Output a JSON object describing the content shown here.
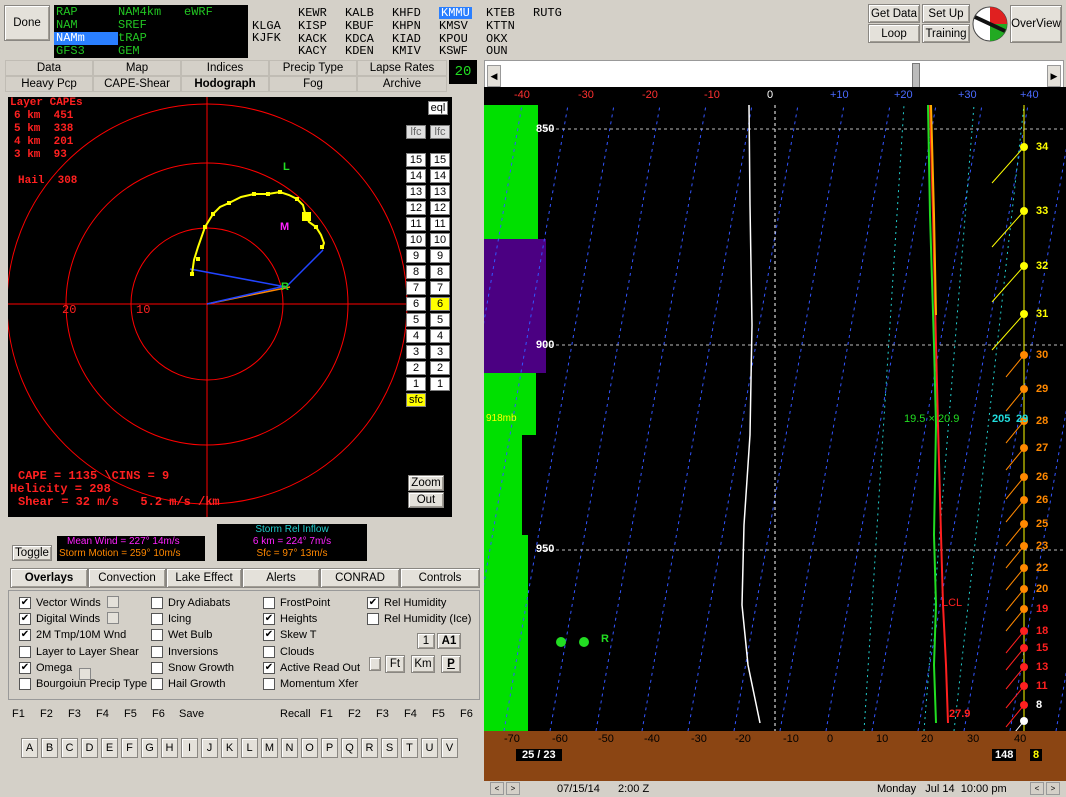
{
  "toolbar": {
    "done": "Done",
    "get_data": "Get Data",
    "set_up": "Set Up",
    "loop": "Loop",
    "training": "Training",
    "overview": "OverView",
    "frame_count": "20"
  },
  "models": [
    {
      "label": "RAP"
    },
    {
      "label": "NAM4km"
    },
    {
      "label": "eWRF"
    },
    {
      "label": "NAM"
    },
    {
      "label": "SREF"
    },
    {
      "label": "NAMm"
    },
    {
      "label": "tRAP"
    },
    {
      "label": "GFS3"
    },
    {
      "label": "GEM"
    }
  ],
  "stations": [
    "KLGA",
    "KJFK",
    "KEWR",
    "KISP",
    "KACK",
    "KACY",
    "KALB",
    "KBUF",
    "KDCA",
    "KDEN",
    "KHFD",
    "KHPN",
    "KIAD",
    "KMIV",
    "KMMU",
    "KMSV",
    "KPOU",
    "KSWF",
    "KTEB",
    "KTTN",
    "OKX",
    "OUN",
    "RUTG"
  ],
  "tabs_row1": [
    "Data",
    "Map",
    "Indices",
    "Precip Type",
    "Lapse Rates"
  ],
  "tabs_row2": [
    "Heavy Pcp",
    "CAPE-Shear",
    "Hodograph",
    "Fog",
    "Archive"
  ],
  "hodograph": {
    "layer_capes_title": "Layer CAPEs",
    "layer_capes": [
      "6 km  451",
      "5 km  338",
      "4 km  201",
      "3 km  93"
    ],
    "hail": "Hail  308",
    "ring_labels": [
      "20",
      "10"
    ],
    "marker_L": "L",
    "marker_M": "M",
    "marker_R": "R",
    "eql": "eql",
    "lfc1": "lfc",
    "lfc2": "lfc",
    "levels_left": [
      "15",
      "14",
      "13",
      "12",
      "11",
      "10",
      "9",
      "8",
      "7",
      "6",
      "5",
      "4",
      "3",
      "2",
      "1"
    ],
    "levels_right": [
      "15",
      "14",
      "13",
      "12",
      "11",
      "10",
      "9",
      "8",
      "7",
      "6",
      "5",
      "4",
      "3",
      "2",
      "1"
    ],
    "sfc": "sfc",
    "cape": "CAPE = 1135 \\CINS = 9",
    "helicity": "Helicity = 298",
    "shear": "Shear = 32 m/s   5.2 m/s /km",
    "zoom": "Zoom",
    "out": "Out"
  },
  "wind_info": {
    "toggle": "Toggle",
    "mean_wind": "Mean Wind = 227°  14m/s",
    "storm_motion": "Storm Motion = 259°  10m/s",
    "sri_title": "Storm Rel Inflow",
    "sri_6km": "6 km = 224°  7m/s",
    "sri_sfc": "Sfc = 97°  13m/s"
  },
  "section_tabs": [
    "Overlays",
    "Convection",
    "Lake Effect",
    "Alerts",
    "CONRAD",
    "Controls"
  ],
  "overlays": {
    "col1": [
      {
        "label": "Vector Winds",
        "checked": true
      },
      {
        "label": "Digital Winds",
        "checked": true
      },
      {
        "label": "2M Tmp/10M Wnd",
        "checked": true
      },
      {
        "label": "Layer to Layer Shear",
        "checked": false
      },
      {
        "label": "Omega",
        "checked": true
      },
      {
        "label": "Bourgoiun Precip Type",
        "checked": false
      }
    ],
    "col2": [
      {
        "label": "Dry Adiabats",
        "checked": false
      },
      {
        "label": "Icing",
        "checked": false
      },
      {
        "label": "Wet Bulb",
        "checked": false
      },
      {
        "label": "Inversions",
        "checked": false
      },
      {
        "label": "Snow Growth",
        "checked": false
      },
      {
        "label": "Hail Growth",
        "checked": false
      }
    ],
    "col3": [
      {
        "label": "FrostPoint",
        "checked": false
      },
      {
        "label": "Heights",
        "checked": true
      },
      {
        "label": "Skew T",
        "checked": true
      },
      {
        "label": "Clouds",
        "checked": false
      },
      {
        "label": "Active Read Out",
        "checked": true
      },
      {
        "label": "Momentum Xfer",
        "checked": false
      }
    ],
    "col4": [
      {
        "label": "Rel Humidity",
        "checked": true
      },
      {
        "label": "Rel Humidity (Ice)",
        "checked": false
      }
    ],
    "btn_1": "1",
    "btn_A1": "A1",
    "btn_Ft": "Ft",
    "btn_Km": "Km",
    "btn_P": "P"
  },
  "fkeys": {
    "save_keys": [
      "F1",
      "F2",
      "F3",
      "F4",
      "F5",
      "F6"
    ],
    "save": "Save",
    "recall": "Recall",
    "recall_keys": [
      "F1",
      "F2",
      "F3",
      "F4",
      "F5",
      "F6"
    ]
  },
  "letters": [
    "A",
    "B",
    "C",
    "D",
    "E",
    "F",
    "G",
    "H",
    "I",
    "J",
    "K",
    "L",
    "M",
    "N",
    "O",
    "P",
    "Q",
    "R",
    "S",
    "T",
    "U",
    "V"
  ],
  "skewt": {
    "top_axis": [
      "-40",
      "-30",
      "-20",
      "-10",
      "0",
      "+10",
      "+20",
      "+30",
      "+40"
    ],
    "bottom_axis": [
      "-70",
      "-60",
      "-50",
      "-40",
      "-30",
      "-20",
      "-10",
      "0",
      "10",
      "20",
      "30",
      "40"
    ],
    "pressure_labels": [
      "850",
      "900",
      "950"
    ],
    "layer_label": "918mb",
    "readout": "19.5 × 20.9",
    "readout_height": "205",
    "readout_speed": "29",
    "lcl": "LCL",
    "sfc_temp": "27.9",
    "sfc_td_pair": "25 / 23",
    "sfc_wind_speed": "148",
    "sfc_wind_digit": "8",
    "omega_marker": "R",
    "wind_speeds": [
      "34",
      "33",
      "32",
      "31",
      "30",
      "29",
      "28",
      "27",
      "26",
      "26",
      "25",
      "23",
      "22",
      "20",
      "19",
      "18",
      "15",
      "13",
      "11",
      "8"
    ]
  },
  "statusbar": {
    "date": "07/15/14",
    "time": "2:00 Z",
    "local": "Monday   Jul 14  10:00 pm"
  },
  "colors": {
    "hodo_red": "#ff0000",
    "hodo_yellow": "#ffff00",
    "rh_green": "#00e000",
    "rh_purple": "#4b0082",
    "ground": "#8b4513",
    "selected": "#2a7fff"
  }
}
